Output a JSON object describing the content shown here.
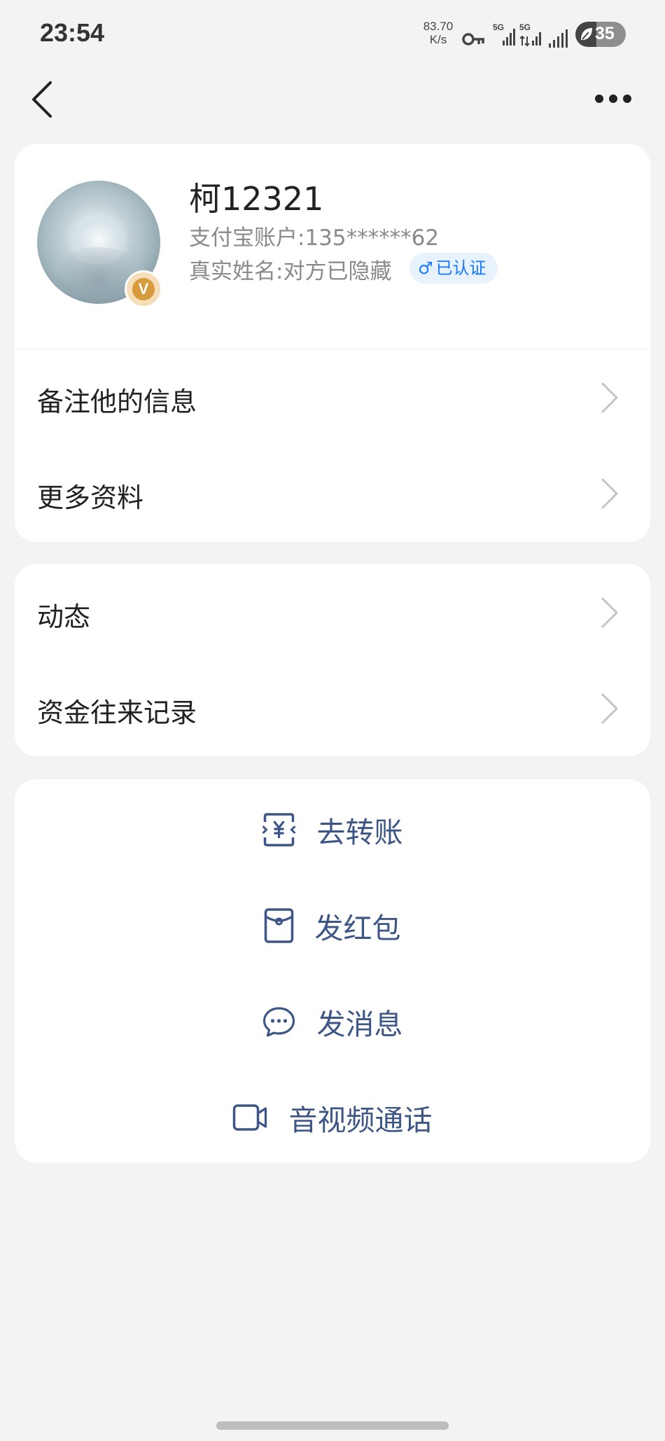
{
  "status_bar": {
    "time": "23:54",
    "speed_value": "83.70",
    "speed_unit": "K/s",
    "network_1": "5G",
    "network_2": "5G",
    "battery": "35"
  },
  "profile": {
    "name": "柯12321",
    "account": "支付宝账户:135******62",
    "real_name": "真实姓名:对方已隐藏",
    "gender_symbol": "♂",
    "verified": "已认证"
  },
  "menu": {
    "remark": "备注他的信息",
    "more_info": "更多资料",
    "moments": "动态",
    "records": "资金往来记录"
  },
  "actions": {
    "transfer": "去转账",
    "red_packet": "发红包",
    "message": "发消息",
    "av_call": "音视频通话"
  },
  "colors": {
    "accent_text": "#3e5686",
    "verified_blue": "#1677ff",
    "background": "#f3f3f4"
  }
}
